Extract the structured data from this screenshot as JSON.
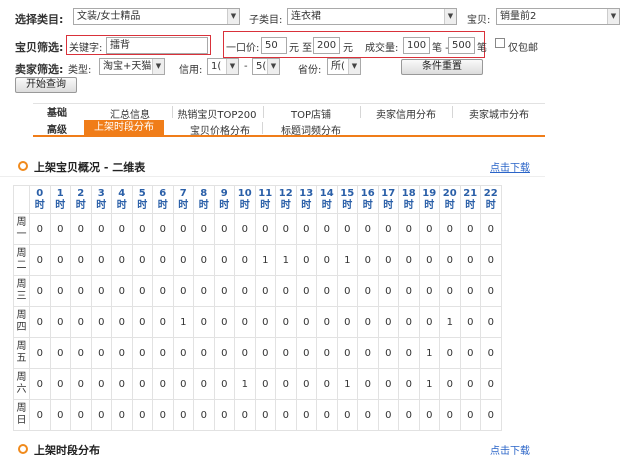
{
  "filters": {
    "category_label": "选择类目:",
    "category_value": "文装/女士精品",
    "subcategory_label": "子类目:",
    "subcategory_value": "连衣裙",
    "item_label": "宝贝:",
    "item_value": "销量前2",
    "item_filter_label": "宝贝筛选:",
    "keyword_prefix": "关键字:",
    "keyword_value": "擂背",
    "price_label": "一口价:",
    "price_min": "50",
    "price_unit_to": "元 至",
    "price_max": "200",
    "price_unit": "元",
    "volume_label": "成交量:",
    "volume_min": "100",
    "volume_unit_to": "笔 -",
    "volume_max": "500",
    "volume_unit": "笔",
    "free_ship_label": "仅包邮",
    "seller_filter_label": "卖家筛选:",
    "type_label": "类型:",
    "type_value": "淘宝+天猫",
    "credit_label": "信用:",
    "credit_min": "1(",
    "credit_sep": "-",
    "credit_max": "5(",
    "province_label": "省份:",
    "province_value": "所(",
    "reset_button": "条件重置",
    "query_button": "开始查询"
  },
  "tabs": {
    "row1_header": "基础",
    "row1": [
      "汇总信息",
      "热销宝贝TOP200",
      "TOP店铺",
      "卖家信用分布",
      "卖家城市分布"
    ],
    "row2_header": "高级",
    "row2": [
      "上架时段分布",
      "宝贝价格分布",
      "标题词频分布"
    ],
    "active": "上架时段分布"
  },
  "section1": {
    "title": "上架宝贝概况 - 二维表",
    "link": "点击下载"
  },
  "section2": {
    "title": "上架时段分布",
    "link": "点击下载"
  },
  "table": {
    "hours": [
      "0",
      "1",
      "2",
      "3",
      "4",
      "5",
      "6",
      "7",
      "8",
      "9",
      "10",
      "11",
      "12",
      "13",
      "14",
      "15",
      "16",
      "17",
      "18",
      "19",
      "20",
      "21",
      "22"
    ],
    "hour_suffix": "时",
    "days": [
      "周一",
      "周二",
      "周三",
      "周四",
      "周五",
      "周六",
      "周日"
    ],
    "values": [
      [
        0,
        0,
        0,
        0,
        0,
        0,
        0,
        0,
        0,
        0,
        0,
        0,
        0,
        0,
        0,
        0,
        0,
        0,
        0,
        0,
        0,
        0,
        0
      ],
      [
        0,
        0,
        0,
        0,
        0,
        0,
        0,
        0,
        0,
        0,
        0,
        1,
        1,
        0,
        0,
        1,
        0,
        0,
        0,
        0,
        0,
        0,
        0
      ],
      [
        0,
        0,
        0,
        0,
        0,
        0,
        0,
        0,
        0,
        0,
        0,
        0,
        0,
        0,
        0,
        0,
        0,
        0,
        0,
        0,
        0,
        0,
        0
      ],
      [
        0,
        0,
        0,
        0,
        0,
        0,
        0,
        1,
        0,
        0,
        0,
        0,
        0,
        0,
        0,
        0,
        0,
        0,
        0,
        0,
        1,
        0,
        0
      ],
      [
        0,
        0,
        0,
        0,
        0,
        0,
        0,
        0,
        0,
        0,
        0,
        0,
        0,
        0,
        0,
        0,
        0,
        0,
        0,
        1,
        0,
        0,
        0
      ],
      [
        0,
        0,
        0,
        0,
        0,
        0,
        0,
        0,
        0,
        0,
        1,
        0,
        0,
        0,
        0,
        1,
        0,
        0,
        0,
        1,
        0,
        0,
        0
      ],
      [
        0,
        0,
        0,
        0,
        0,
        0,
        0,
        0,
        0,
        0,
        0,
        0,
        0,
        0,
        0,
        0,
        0,
        0,
        0,
        0,
        0,
        0,
        0
      ]
    ]
  }
}
